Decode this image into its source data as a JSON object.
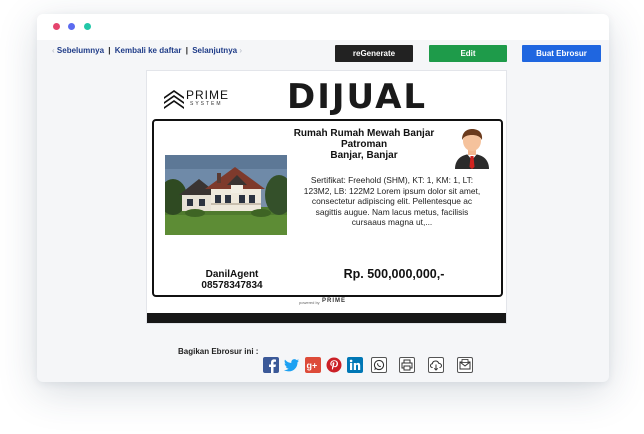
{
  "nav": {
    "prev": "Sebelumnya",
    "back": "Kembali ke daftar",
    "next": "Selanjutnya",
    "separator": "|"
  },
  "toolbar": {
    "regenerate": "reGenerate",
    "edit": "Edit",
    "buat": "Buat Ebrosur"
  },
  "flyer": {
    "logo_word": "PRIME",
    "logo_sub": "SYSTEM",
    "headline": "DIJUAL",
    "title_line1": "Rumah Rumah Mewah Banjar",
    "title_line2": "Patroman",
    "title_line3": "Banjar, Banjar",
    "description": "Sertifikat: Freehold (SHM), KT: 1, KM: 1, LT: 123M2, LB: 122M2 Lorem ipsum dolor sit amet, consectetur adipiscing elit. Pellentesque ac sagittis augue. Nam lacus metus, facilisis cursaaus magna ut,...",
    "agent_name": "DanilAgent",
    "agent_phone": "08578347834",
    "price": "Rp. 500,000,000,-",
    "powered_by": "powered by",
    "powered_logo": "PRIME"
  },
  "share": {
    "label": "Bagikan Ebrosur ini :",
    "icons": [
      "facebook-icon",
      "twitter-icon",
      "google-plus-icon",
      "pinterest-icon",
      "linkedin-icon",
      "whatsapp-icon",
      "print-icon",
      "download-icon",
      "email-icon"
    ]
  },
  "colors": {
    "regenerate_bg": "#222222",
    "edit_bg": "#1e9b4a",
    "buat_bg": "#1f66e0",
    "nav_link": "#1f3c88",
    "facebook": "#3b5998",
    "twitter": "#1da1f2",
    "google_plus": "#dd4b39",
    "pinterest": "#cb2027",
    "linkedin": "#0077b5"
  }
}
